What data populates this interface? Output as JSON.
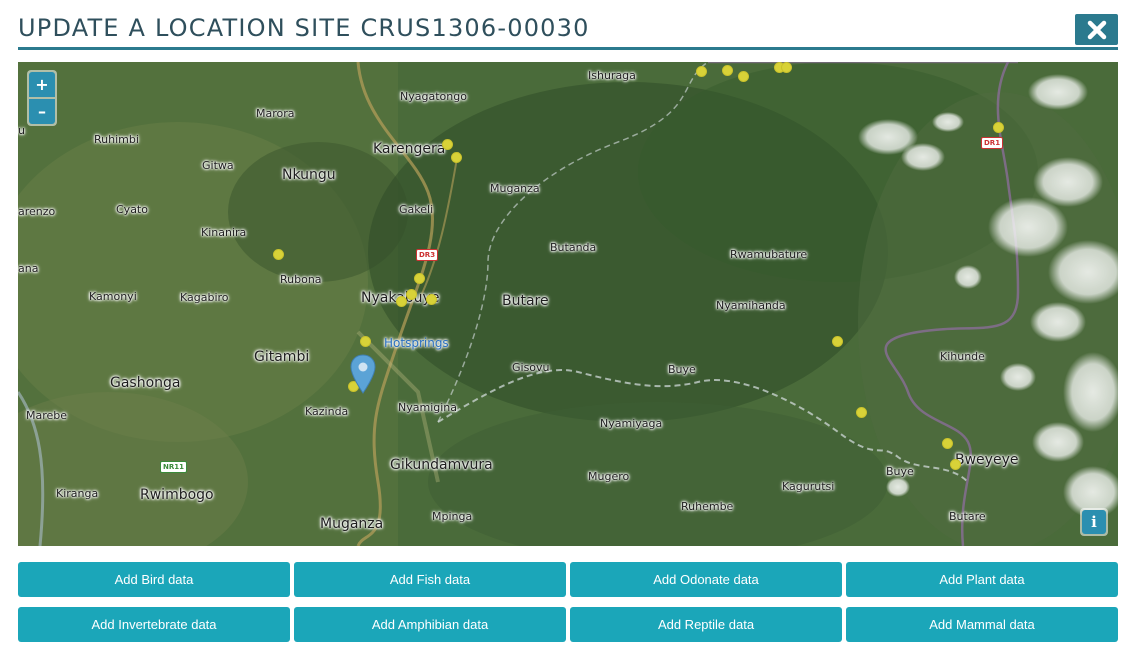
{
  "dialog": {
    "title": "UPDATE A LOCATION SITE CRUS1306-00030",
    "close_icon": "close-icon"
  },
  "map": {
    "zoom_in_label": "+",
    "zoom_out_label": "–",
    "info_label": "i",
    "place_labels": [
      "Ishuraga",
      "Nyagatongo",
      "Marora",
      "Ruhimbi",
      "Karengera",
      "Gitwa",
      "Nkungu",
      "Muganza",
      "Cyato",
      "arenzo",
      "Gakeli",
      "Kinanira",
      "Butanda",
      "Rwamubature",
      "ana",
      "Rubona",
      "Kamonyi",
      "Kagabiro",
      "Nyakabuye",
      "Butare",
      "Nyamihanda",
      "Hotsprings",
      "Gitambi",
      "Gisovu",
      "Buye",
      "Kihunde",
      "Gashonga",
      "Kazinda",
      "Nyamigina",
      "Marebe",
      "Nyamiyaga",
      "Buye",
      "Bweyeye",
      "Gikundamvura",
      "Kiranga",
      "Rwimbogo",
      "Mugero",
      "Kagurutsi",
      "Ruhembe",
      "Butare",
      "Mpinga",
      "Muganza",
      "u"
    ],
    "road_labels": [
      "DR3",
      "DR1",
      "NR11"
    ],
    "colors": {
      "site_dot": "#d8d238",
      "marker": "#5ba3d6",
      "control": "#2b8fb0"
    }
  },
  "actions": [
    "Add Bird data",
    "Add Fish data",
    "Add Odonate data",
    "Add Plant data",
    "Add Invertebrate data",
    "Add Amphibian data",
    "Add Reptile data",
    "Add Mammal data"
  ],
  "colors": {
    "accent": "#2b7a8e",
    "button": "#1ba6b9"
  }
}
